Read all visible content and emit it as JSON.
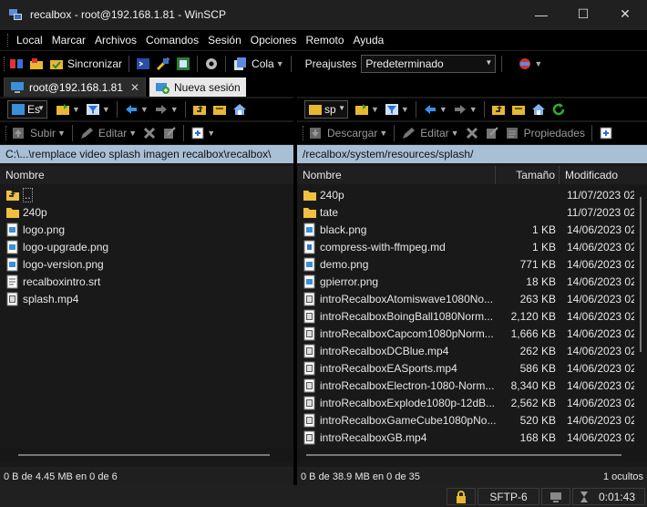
{
  "window": {
    "title": "recalbox - root@192.168.1.81 - WinSCP",
    "minimize": "—",
    "maximize": "☐",
    "close": "✕"
  },
  "menu": [
    "Local",
    "Marcar",
    "Archivos",
    "Comandos",
    "Sesión",
    "Opciones",
    "Remoto",
    "Ayuda"
  ],
  "toolbar": {
    "sync_label": "Sincronizar",
    "queue_label": "Cola",
    "presets_label": "Preajustes",
    "preset_value": "Predeterminado"
  },
  "tabs": {
    "session_label": "root@192.168.1.81",
    "new_session_label": "Nueva sesión"
  },
  "left": {
    "drive": "Es",
    "upload_label": "Subir",
    "edit_label": "Editar",
    "path": "C:\\...\\remplace video splash imagen recalbox\\recalbox\\",
    "col_name": "Nombre",
    "files": [
      {
        "name": "..",
        "type": "up"
      },
      {
        "name": "240p",
        "type": "folder"
      },
      {
        "name": "logo.png",
        "type": "image"
      },
      {
        "name": "logo-upgrade.png",
        "type": "image"
      },
      {
        "name": "logo-version.png",
        "type": "image"
      },
      {
        "name": "recalboxintro.srt",
        "type": "doc"
      },
      {
        "name": "splash.mp4",
        "type": "video"
      }
    ],
    "status": "0 B de 4.45 MB en 0 de 6"
  },
  "right": {
    "drive": "sp",
    "download_label": "Descargar",
    "edit_label": "Editar",
    "properties_label": "Propiedades",
    "path": "/recalbox/system/resources/splash/",
    "col_name": "Nombre",
    "col_size": "Tamaño",
    "col_modified": "Modificado",
    "files": [
      {
        "name": "240p",
        "size": "",
        "modified": "11/07/2023 02",
        "type": "folder"
      },
      {
        "name": "tate",
        "size": "",
        "modified": "11/07/2023 02",
        "type": "folder"
      },
      {
        "name": "black.png",
        "size": "1 KB",
        "modified": "14/06/2023 02",
        "type": "image"
      },
      {
        "name": "compress-with-ffmpeg.md",
        "size": "1 KB",
        "modified": "14/06/2023 02",
        "type": "md"
      },
      {
        "name": "demo.png",
        "size": "771 KB",
        "modified": "14/06/2023 02",
        "type": "image"
      },
      {
        "name": "gpierror.png",
        "size": "18 KB",
        "modified": "14/06/2023 02",
        "type": "image"
      },
      {
        "name": "introRecalboxAtomiswave1080No...",
        "size": "263 KB",
        "modified": "14/06/2023 02",
        "type": "video"
      },
      {
        "name": "introRecalboxBoingBall1080Norm...",
        "size": "2,120 KB",
        "modified": "14/06/2023 02",
        "type": "video"
      },
      {
        "name": "introRecalboxCapcom1080pNorm...",
        "size": "1,666 KB",
        "modified": "14/06/2023 02",
        "type": "video"
      },
      {
        "name": "introRecalboxDCBlue.mp4",
        "size": "262 KB",
        "modified": "14/06/2023 02",
        "type": "video"
      },
      {
        "name": "introRecalboxEASports.mp4",
        "size": "586 KB",
        "modified": "14/06/2023 02",
        "type": "video"
      },
      {
        "name": "introRecalboxElectron-1080-Norm...",
        "size": "8,340 KB",
        "modified": "14/06/2023 02",
        "type": "video"
      },
      {
        "name": "introRecalboxExplode1080p-12dB...",
        "size": "2,562 KB",
        "modified": "14/06/2023 02",
        "type": "video"
      },
      {
        "name": "introRecalboxGameCube1080pNo...",
        "size": "520 KB",
        "modified": "14/06/2023 02",
        "type": "video"
      },
      {
        "name": "introRecalboxGB.mp4",
        "size": "168 KB",
        "modified": "14/06/2023 02",
        "type": "video"
      }
    ],
    "status": "0 B de 38.9 MB en 0 de 35",
    "hidden": "1 ocultos"
  },
  "bottom": {
    "protocol": "SFTP-6",
    "elapsed": "0:01:43"
  }
}
